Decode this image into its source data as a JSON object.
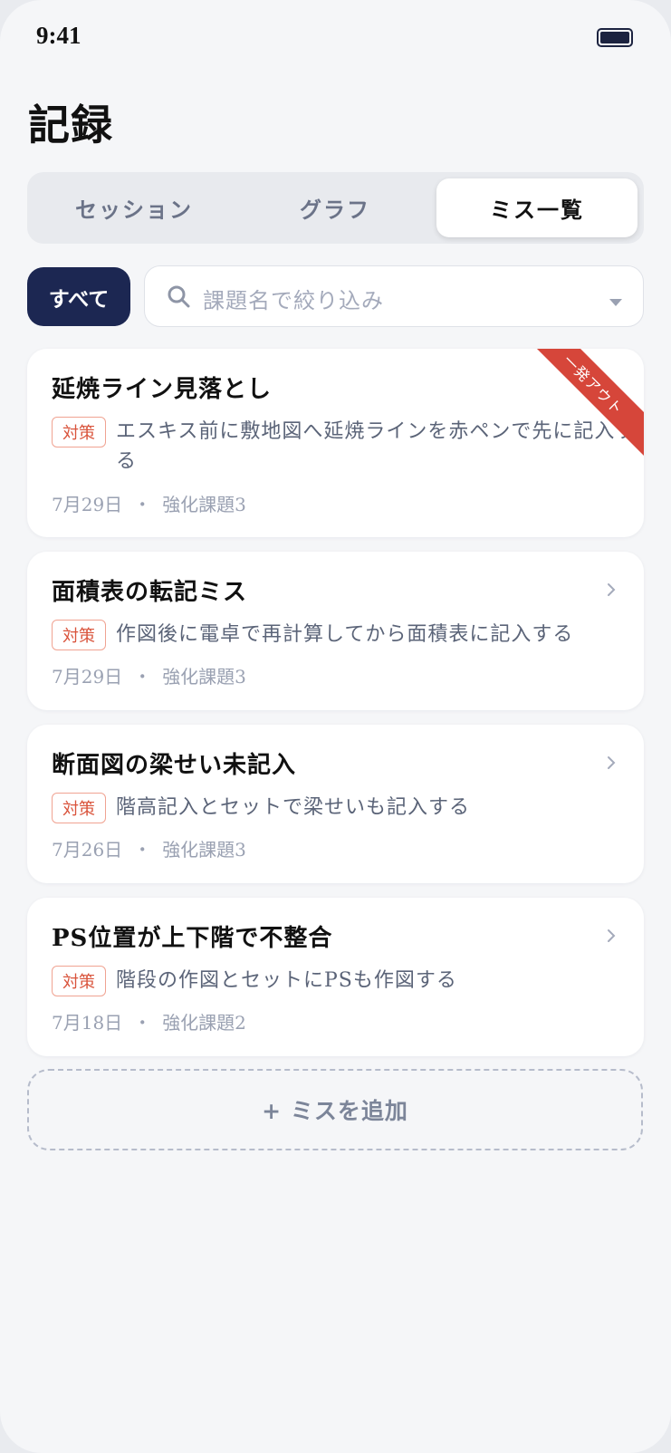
{
  "status": {
    "time": "9:41"
  },
  "page": {
    "title": "記録"
  },
  "tabs": [
    {
      "label": "セッション"
    },
    {
      "label": "グラフ"
    },
    {
      "label": "ミス一覧"
    }
  ],
  "filter": {
    "all_label": "すべて",
    "search_placeholder": "課題名で絞り込み"
  },
  "mistakes": [
    {
      "title": "延焼ライン見落とし",
      "tag": "対策",
      "measure": "エスキス前に敷地図へ延焼ラインを赤ペンで先に記入する",
      "date": "7月29日",
      "separator": "・",
      "assignment": "強化課題3",
      "ribbon": "一発アウト"
    },
    {
      "title": "面積表の転記ミス",
      "tag": "対策",
      "measure": "作図後に電卓で再計算してから面積表に記入する",
      "date": "7月29日",
      "separator": "・",
      "assignment": "強化課題3"
    },
    {
      "title": "断面図の梁せい未記入",
      "tag": "対策",
      "measure": "階高記入とセットで梁せいも記入する",
      "date": "7月26日",
      "separator": "・",
      "assignment": "強化課題3"
    },
    {
      "title": "PS位置が上下階で不整合",
      "tag": "対策",
      "measure": "階段の作図とセットにPSも作図する",
      "date": "7月18日",
      "separator": "・",
      "assignment": "強化課題2"
    }
  ],
  "add_button": {
    "label": "+ ミスを追加"
  },
  "colors": {
    "primary": "#1c2752",
    "tag": "#d9533b",
    "ribbon": "#d6463a",
    "background": "#f5f6f8"
  },
  "icons": [
    "battery-icon",
    "search-icon",
    "dropdown-caret-icon",
    "chevron-right-icon"
  ]
}
